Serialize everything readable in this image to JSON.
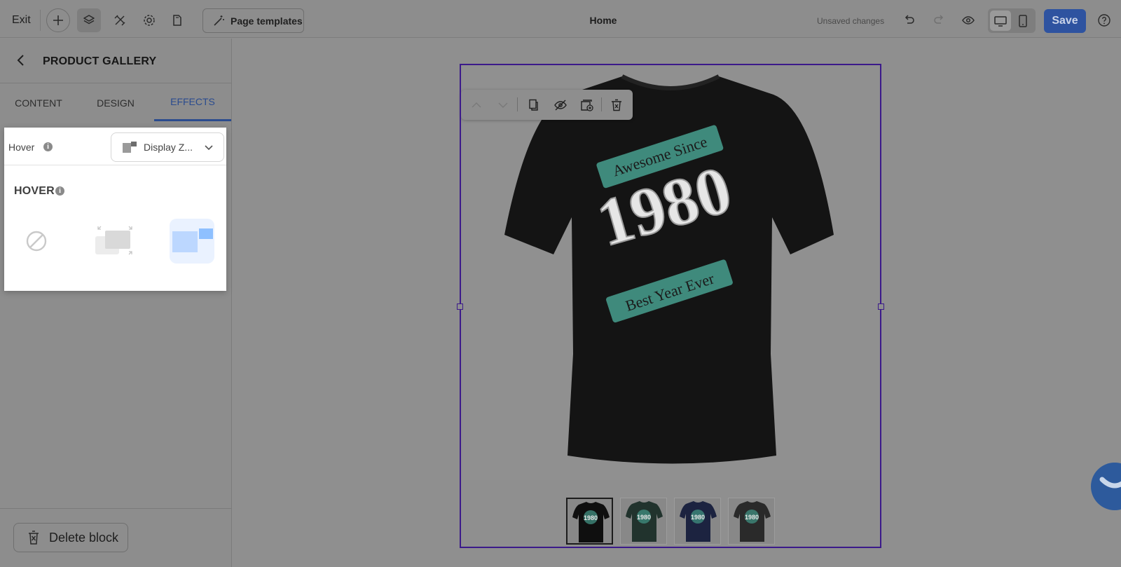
{
  "topbar": {
    "exit_label": "Exit",
    "templates_label": "Page templates",
    "page_title": "Home",
    "status_text": "Unsaved changes",
    "save_label": "Save"
  },
  "panel": {
    "title": "PRODUCT GALLERY",
    "tabs": [
      {
        "label": "CONTENT",
        "active": false
      },
      {
        "label": "DESIGN",
        "active": false
      },
      {
        "label": "EFFECTS",
        "active": true
      }
    ],
    "hover_label": "Hover",
    "hover_select_value": "Display Z...",
    "section_heading": "HOVER",
    "effect_options": [
      {
        "name": "none-effect",
        "selected": false
      },
      {
        "name": "zoom-effect",
        "selected": false
      },
      {
        "name": "display-zoom-effect",
        "selected": true
      }
    ],
    "delete_label": "Delete block"
  },
  "canvas": {
    "image_caption": "Awesome Since 1980 Best Year Ever",
    "thumbnails": [
      {
        "color": "#0f0f0f",
        "active": true
      },
      {
        "color": "#21332d",
        "active": false
      },
      {
        "color": "#1c2340",
        "active": false
      },
      {
        "color": "#2a2a2a",
        "active": false
      }
    ]
  },
  "colors": {
    "accent": "#2a4b8e",
    "selection": "#3b1a8a",
    "save": "#2e53a0"
  }
}
